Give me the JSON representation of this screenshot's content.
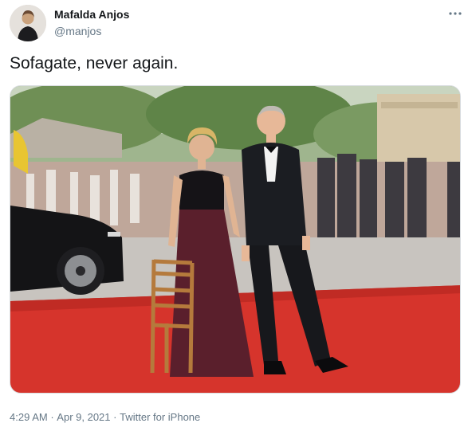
{
  "author": {
    "name": "Mafalda Anjos",
    "handle": "@manjos"
  },
  "tweet": {
    "text": "Sofagate, never again."
  },
  "icons": {
    "more": "more-horizontal-icon"
  },
  "meta": {
    "time": "4:29 AM",
    "sep1": "·",
    "date": "Apr 9, 2021",
    "sep2": "·",
    "source": "Twitter for iPhone"
  }
}
